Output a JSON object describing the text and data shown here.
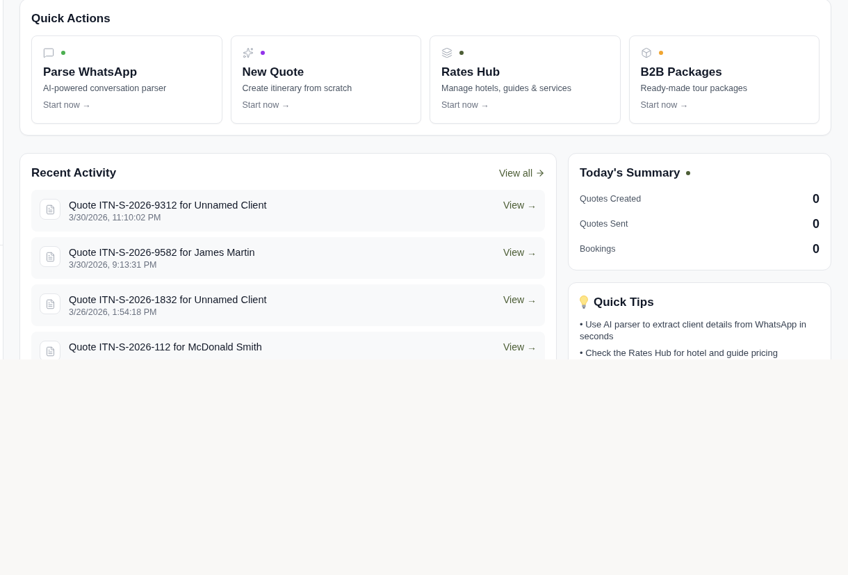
{
  "quick_actions": {
    "title": "Quick Actions",
    "items": [
      {
        "title": "Parse WhatsApp",
        "description": "AI-powered conversation parser",
        "link": "Start now →",
        "color": "#4caf50"
      },
      {
        "title": "New Quote",
        "description": "Create itinerary from scratch",
        "link": "Start now →",
        "color": "#9333ea"
      },
      {
        "title": "Rates Hub",
        "description": "Manage hotels, guides & services",
        "link": "Start now →",
        "color": "#4d5e36"
      },
      {
        "title": "B2B Packages",
        "description": "Ready-made tour packages",
        "link": "Start now →",
        "color": "#f0a531"
      }
    ]
  },
  "recent_activity": {
    "title": "Recent Activity",
    "view_all": "View all",
    "items": [
      {
        "title": "Quote ITN-S-2026-9312 for Unnamed Client",
        "date": "3/30/2026, 11:10:02 PM",
        "link": "View →"
      },
      {
        "title": "Quote ITN-S-2026-9582 for James Martin",
        "date": "3/30/2026, 9:13:31 PM",
        "link": "View →"
      },
      {
        "title": "Quote ITN-S-2026-1832 for Unnamed Client",
        "date": "3/26/2026, 1:54:18 PM",
        "link": "View →"
      },
      {
        "title": "Quote ITN-S-2026-112 for McDonald Smith",
        "link": "View →"
      }
    ]
  },
  "summary": {
    "title": "Today's Summary",
    "stats": [
      {
        "label": "Quotes Created",
        "value": "0"
      },
      {
        "label": "Quotes Sent",
        "value": "0"
      },
      {
        "label": "Bookings",
        "value": "0"
      }
    ]
  },
  "tips": {
    "title": "Quick Tips",
    "items": [
      "• Use AI parser to extract client details from WhatsApp in seconds",
      "• Check the Rates Hub for hotel and guide pricing"
    ]
  }
}
